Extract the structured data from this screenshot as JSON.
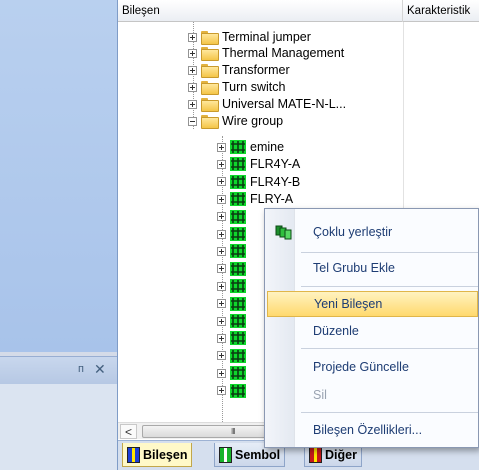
{
  "left_panel": {
    "pin_glyph": "ᴨ",
    "close_glyph": "✕"
  },
  "tree": {
    "columns": [
      "Bileşen",
      "Karakteristik"
    ],
    "folders": [
      {
        "label": "Terminal jumper",
        "expanded": false
      },
      {
        "label": "Thermal Management",
        "expanded": false
      },
      {
        "label": "Transformer",
        "expanded": false
      },
      {
        "label": "Turn switch",
        "expanded": false
      },
      {
        "label": "Universal MATE-N-L...",
        "expanded": false
      },
      {
        "label": "Wire group",
        "expanded": true
      }
    ],
    "wire_group_children": [
      {
        "label": "emine"
      },
      {
        "label": "FLR4Y-A"
      },
      {
        "label": "FLR4Y-B"
      },
      {
        "label": "FLRY-A"
      },
      {
        "label": ""
      },
      {
        "label": ""
      },
      {
        "label": ""
      },
      {
        "label": ""
      },
      {
        "label": ""
      },
      {
        "label": ""
      },
      {
        "label": ""
      },
      {
        "label": ""
      },
      {
        "label": ""
      },
      {
        "label": ""
      },
      {
        "label": ""
      }
    ]
  },
  "scrollbar": {
    "left_arrow": "<",
    "grip": "III"
  },
  "tabs": [
    {
      "label": "Bileşen",
      "active": true,
      "icon_colors": [
        "#1c3fd8",
        "#ffe600",
        "#1c3fd8"
      ]
    },
    {
      "label": "Sembol",
      "active": false,
      "icon_colors": [
        "#17b42a",
        "#ffffff",
        "#17b42a"
      ]
    },
    {
      "label": "Diğer",
      "active": false,
      "icon_colors": [
        "#c71b1b",
        "#ffe600",
        "#c71b1b"
      ]
    }
  ],
  "context_menu": {
    "items": [
      {
        "label": "Çoklu yerleştir",
        "icon": "multi-place-icon",
        "state": "normal"
      },
      {
        "label": "Tel Grubu Ekle",
        "icon": "",
        "state": "normal"
      },
      {
        "label": "Yeni Bileşen",
        "icon": "",
        "state": "highlighted"
      },
      {
        "label": "Düzenle",
        "icon": "",
        "state": "normal"
      },
      {
        "label": "Projede Güncelle",
        "icon": "",
        "state": "normal"
      },
      {
        "label": "Sil",
        "icon": "",
        "state": "disabled"
      },
      {
        "label": "Bileşen Özellikleri...",
        "icon": "",
        "state": "normal"
      }
    ]
  },
  "colors": {
    "wire_icon_green": "#0fd62c",
    "wire_icon_dark": "#0a3b12",
    "highlight": "#ffd96e",
    "menu_text": "#1d3c73"
  }
}
